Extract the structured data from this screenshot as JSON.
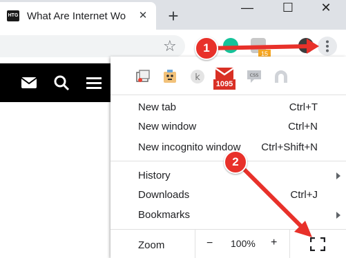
{
  "browser": {
    "tab": {
      "favicon_text": "HTG",
      "title": "What Are Internet Wo",
      "close_glyph": "✕"
    },
    "new_tab_glyph": "+",
    "window_controls": {
      "minimize": "—",
      "maximize": "☐",
      "close": "✕"
    },
    "star_glyph": "☆",
    "extension_badge": "15"
  },
  "menu": {
    "extensions": [
      {
        "name": "screen-capture-icon"
      },
      {
        "name": "toolbox-icon"
      },
      {
        "name": "k-extension-icon",
        "glyph": "k"
      },
      {
        "name": "gmail-icon",
        "badge": "1095"
      },
      {
        "name": "css-icon",
        "glyph": "CSS"
      },
      {
        "name": "vpn-icon"
      }
    ],
    "group1": [
      {
        "label": "New tab",
        "shortcut": "Ctrl+T"
      },
      {
        "label": "New window",
        "shortcut": "Ctrl+N"
      },
      {
        "label": "New incognito window",
        "shortcut": "Ctrl+Shift+N"
      }
    ],
    "group2": [
      {
        "label": "History",
        "submenu": true
      },
      {
        "label": "Downloads",
        "shortcut": "Ctrl+J"
      },
      {
        "label": "Bookmarks",
        "submenu": true
      }
    ],
    "zoom": {
      "label": "Zoom",
      "minus": "−",
      "value": "100%",
      "plus": "+"
    }
  },
  "annotations": {
    "step1": "1",
    "step2": "2",
    "color": "#e8312a"
  },
  "colors": {
    "tabstrip": "#dee1e6",
    "site_header": "#000000",
    "arrow": "#e8312a"
  }
}
